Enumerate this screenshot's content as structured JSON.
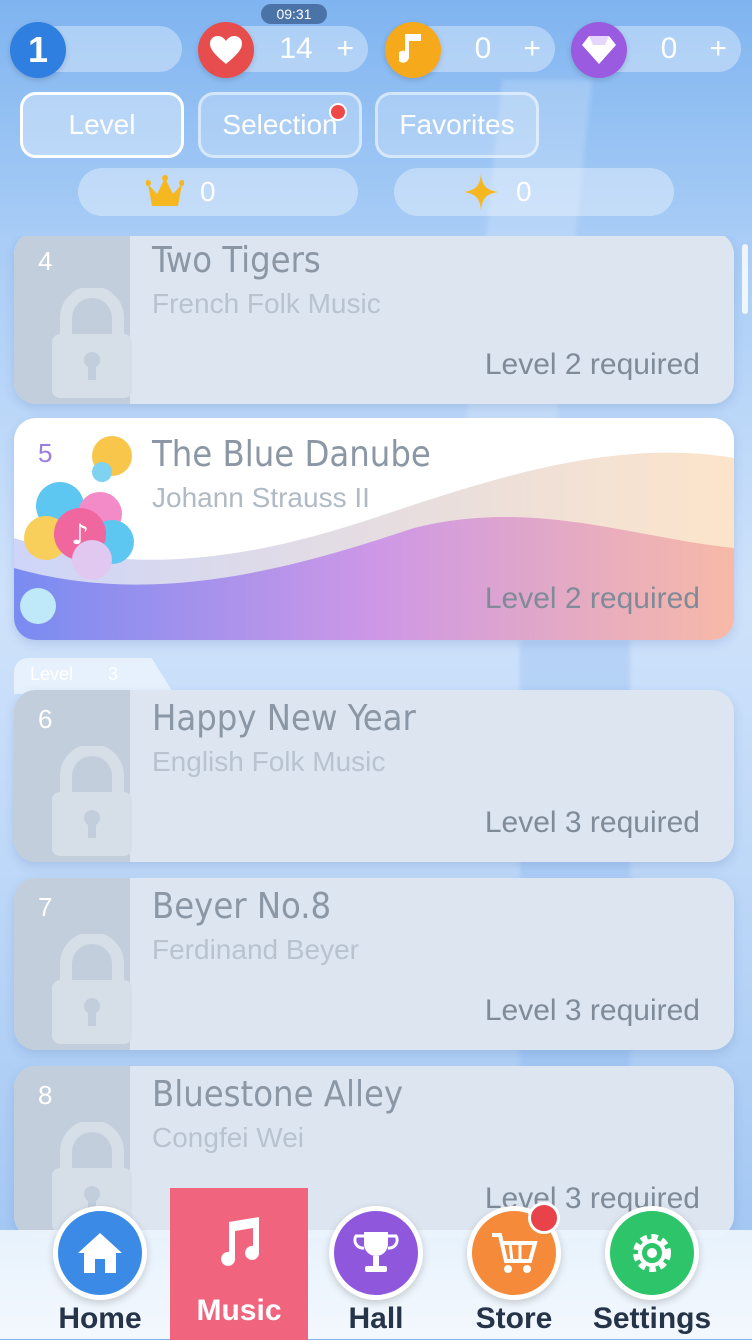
{
  "status": {
    "clock": "09:31"
  },
  "stats": {
    "level": "1",
    "lives": "14",
    "notes": "0",
    "gems": "0",
    "plus": "+"
  },
  "tabs": [
    {
      "label": "Level",
      "active": true
    },
    {
      "label": "Selection",
      "active": false,
      "has_dot": true
    },
    {
      "label": "Favorites",
      "active": false
    }
  ],
  "counters": {
    "crowns": "0",
    "stars": "0"
  },
  "songs": [
    {
      "index": "4",
      "title": "Two Tigers",
      "artist": "French Folk Music",
      "requirement": "Level 2 required",
      "locked": true
    },
    {
      "index": "5",
      "title": "The Blue Danube",
      "artist": "Johann Strauss II",
      "requirement": "Level 2 required",
      "locked": false
    },
    {
      "index": "6",
      "title": "Happy New Year",
      "artist": "English Folk Music",
      "requirement": "Level 3 required",
      "locked": true
    },
    {
      "index": "7",
      "title": "Beyer No.8",
      "artist": "Ferdinand Beyer",
      "requirement": "Level 3 required",
      "locked": true
    },
    {
      "index": "8",
      "title": "Bluestone Alley",
      "artist": "Congfei Wei",
      "requirement": "Level 3 required",
      "locked": true
    }
  ],
  "level_group": {
    "label": "Level",
    "number": "3"
  },
  "nav": {
    "home": "Home",
    "music": "Music",
    "hall": "Hall",
    "store": "Store",
    "settings": "Settings"
  },
  "colors": {
    "level_badge": "#2f7fe0",
    "lives_badge": "#e84d4d",
    "notes_badge": "#f6a91a",
    "gems_badge": "#9a5be0",
    "music_tab": "#f0647e"
  }
}
